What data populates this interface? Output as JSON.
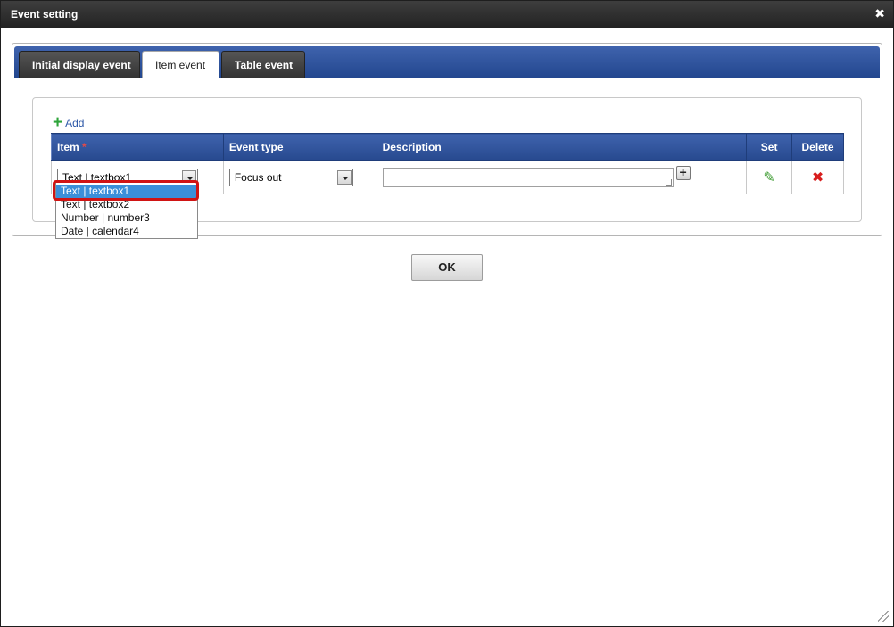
{
  "window": {
    "title": "Event setting",
    "close_glyph": "✖"
  },
  "tabs": [
    {
      "label": "Initial display event",
      "active": false
    },
    {
      "label": "Item event",
      "active": true
    },
    {
      "label": "Table event",
      "active": false
    }
  ],
  "toolbar": {
    "add_label": "Add",
    "add_icon": "plus-icon"
  },
  "table": {
    "headers": {
      "item": "Item",
      "item_required_mark": "*",
      "event_type": "Event type",
      "description": "Description",
      "set": "Set",
      "delete": "Delete"
    },
    "rows": [
      {
        "item": "Text | textbox1",
        "event_type": "Focus out",
        "description": "",
        "add_glyph": "+",
        "set_icon": "pencil-icon",
        "set_glyph": "✎",
        "delete_icon": "delete-x-icon",
        "delete_glyph": "✖"
      }
    ]
  },
  "item_dropdown": {
    "options": [
      {
        "label": "Text | textbox1",
        "selected": true
      },
      {
        "label": "Text | textbox2",
        "selected": false
      },
      {
        "label": "Number | number3",
        "selected": false
      },
      {
        "label": "Date | calendar4",
        "selected": false
      }
    ]
  },
  "footer": {
    "ok_label": "OK"
  },
  "colors": {
    "tab_bar_blue": "#2f54a0",
    "selected_option": "#3b8fd9",
    "highlight_red": "#d01414",
    "add_green": "#2ea43a",
    "delete_red": "#d81e1e"
  }
}
